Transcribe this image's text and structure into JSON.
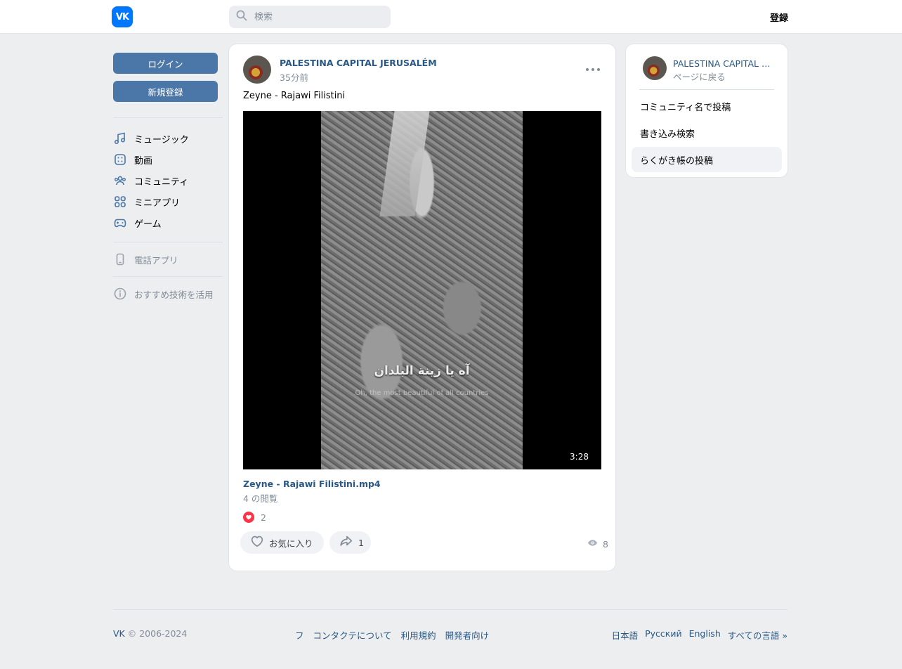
{
  "header": {
    "logo": "VK",
    "search_placeholder": "検索",
    "register_label": "登録"
  },
  "sidebar": {
    "login_label": "ログイン",
    "signup_label": "新規登録",
    "items": [
      {
        "label": "ミュージック",
        "icon": "music-icon"
      },
      {
        "label": "動画",
        "icon": "video-icon"
      },
      {
        "label": "コミュニティ",
        "icon": "community-icon"
      },
      {
        "label": "ミニアプリ",
        "icon": "mini-apps-icon"
      },
      {
        "label": "ゲーム",
        "icon": "gamepad-icon"
      }
    ],
    "phone_app_label": "電話アプリ",
    "tech_label": "おすすめ技術を活用"
  },
  "post": {
    "author": "PALESTINA CAPITAL JERUSALÉM",
    "time": "35分前",
    "text": "Zeyne - Rajawi Filistini",
    "video": {
      "caption_arabic": "آه يا زينة البلدان",
      "caption_english": "Oh, the most beautiful of all countries",
      "duration": "3:28",
      "title": "Zeyne - Rajawi Filistini.mp4",
      "views": "4 の閲覧"
    },
    "reactions_count": "2",
    "like_label": "お気に入り",
    "share_count": "1",
    "views_count": "8"
  },
  "side_panel": {
    "name": "PALESTINA CAPITAL JERUSALÉM",
    "back_label": "ページに戻る",
    "items": [
      "コミュニティ名で投稿",
      "書き込み検索",
      "らくがき帳の投稿"
    ]
  },
  "footer": {
    "brand": "VK",
    "copyright": "© 2006-2024",
    "links": [
      "フ",
      "コンタクテについて",
      "利用規約",
      "開発者向け"
    ],
    "languages": [
      "日本語",
      "Русский",
      "English",
      "すべての言語 »"
    ]
  },
  "colors": {
    "accent": "#4a76a8",
    "link": "#2a5885",
    "brand": "#0077ff",
    "like": "#ff3347"
  }
}
